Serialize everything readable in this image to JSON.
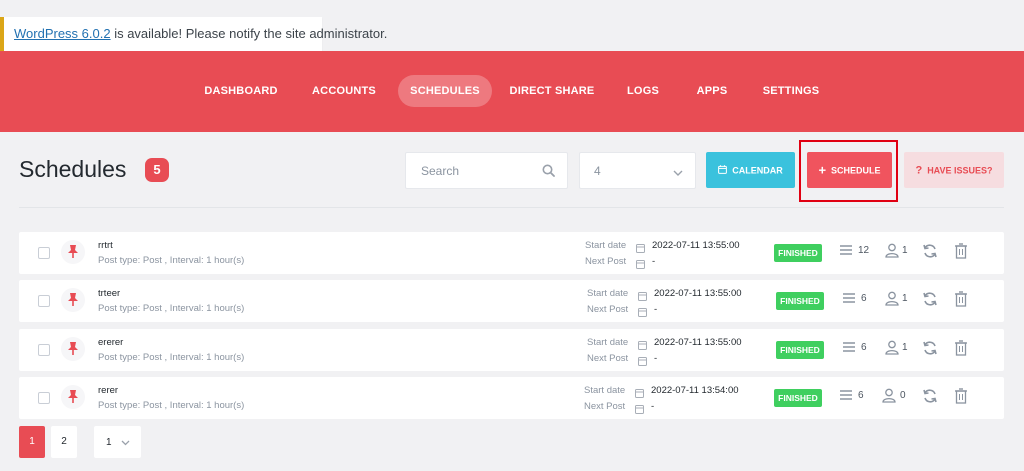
{
  "notice": {
    "link": "WordPress 6.0.2",
    "text": " is available! Please notify the site administrator."
  },
  "nav": [
    "DASHBOARD",
    "ACCOUNTS",
    "SCHEDULES",
    "DIRECT SHARE",
    "LOGS",
    "APPS",
    "SETTINGS"
  ],
  "nav_active": "SCHEDULES",
  "header": {
    "title": "Schedules",
    "count": "5"
  },
  "toolbar": {
    "search_placeholder": "Search",
    "per_page_select": "4",
    "calendar_label": "CALENDAR",
    "schedule_label": "SCHEDULE",
    "issues_label": "HAVE ISSUES?",
    "schedule_icon": "+",
    "issues_icon": "?"
  },
  "labels": {
    "start_date": "Start date",
    "next_post": "Next Post"
  },
  "schedules": [
    {
      "title": "rrtrt",
      "subtitle": "Post type: Post , Interval: 1 hour(s)",
      "start_date": "2022-07-11 13:55:00",
      "next_post": "-",
      "status": "FINISHED",
      "posts": "12",
      "accounts": "1"
    },
    {
      "title": "trteer",
      "subtitle": "Post type: Post , Interval: 1 hour(s)",
      "start_date": "2022-07-11 13:55:00",
      "next_post": "-",
      "status": "FINISHED",
      "posts": "6",
      "accounts": "1"
    },
    {
      "title": "ererer",
      "subtitle": "Post type: Post , Interval: 1 hour(s)",
      "start_date": "2022-07-11 13:55:00",
      "next_post": "-",
      "status": "FINISHED",
      "posts": "6",
      "accounts": "1"
    },
    {
      "title": "rerer",
      "subtitle": "Post type: Post , Interval: 1 hour(s)",
      "start_date": "2022-07-11 13:54:00",
      "next_post": "-",
      "status": "FINISHED",
      "posts": "6",
      "accounts": "0"
    }
  ],
  "pagination": {
    "pages": [
      "1",
      "2"
    ],
    "current": "1",
    "per_page": "1"
  },
  "colors": {
    "brand": "#e84c54",
    "calendar": "#3ac2dd",
    "finished": "#3fcf5f",
    "issues_bg": "#f6dde0",
    "highlight": "#e00012"
  },
  "icons": {
    "search": "search-icon",
    "chevron": "chevron-down-icon",
    "calendar": "calendar-icon",
    "pin": "pin-icon",
    "list": "list-icon",
    "user": "user-icon",
    "refresh": "refresh-icon",
    "trash": "trash-icon"
  }
}
